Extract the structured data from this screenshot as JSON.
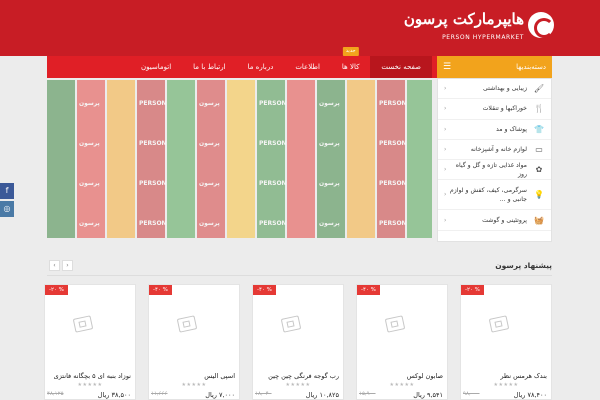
{
  "header": {
    "logo_fa": "هایپرمارکت پرسون",
    "logo_en": "PERSON HYPERMARKET"
  },
  "nav": {
    "categories_label": "دسته‌بندیها",
    "links": [
      {
        "label": "صفحه نخست",
        "badge": ""
      },
      {
        "label": "کالا ها",
        "badge": "جدید"
      },
      {
        "label": "اطلاعات",
        "badge": ""
      },
      {
        "label": "درباره ما",
        "badge": ""
      },
      {
        "label": "ارتباط با ما",
        "badge": ""
      },
      {
        "label": "اتوماسیون",
        "badge": ""
      }
    ]
  },
  "banner": {
    "stripe_texts": [
      "پرسون",
      "PERSON",
      "پرسون",
      "PERSON",
      "پرسون",
      "PERSON",
      "پرسون",
      "PERSON"
    ]
  },
  "categories": [
    {
      "label": "زیبایی و بهداشتی",
      "icon": "brush-icon",
      "glyph": "🖌"
    },
    {
      "label": "خوراکیها و تنقلات",
      "icon": "food-icon",
      "glyph": "🍴"
    },
    {
      "label": "پوشاک و مد",
      "icon": "shirt-icon",
      "glyph": "👕"
    },
    {
      "label": "لوازم خانه و آشپزخانه",
      "icon": "tv-icon",
      "glyph": "▭"
    },
    {
      "label": "مواد غذایی تازه و گل و گیاه روز",
      "icon": "plant-icon",
      "glyph": "✿"
    },
    {
      "label": "سرگرمی، کیف، کفش و لوازم جانبی و ...",
      "icon": "bulb-icon",
      "glyph": "💡"
    },
    {
      "label": "پروتئینی و گوشت",
      "icon": "basket-icon",
      "glyph": "🧺"
    }
  ],
  "social": {
    "facebook": "f",
    "instagram": "◎"
  },
  "suggestions": {
    "title": "پیشنهاد پرسون",
    "prev": "‹",
    "next": "›",
    "products": [
      {
        "discount": "-۲۰ %",
        "name": "بندک هرمس نظر",
        "price": "۷۸,۴۰۰ ریال",
        "old": "۹۸,۰۰۰"
      },
      {
        "discount": "-۴۰ %",
        "name": "صابون لوکس",
        "price": "۹,۵۴۱ ریال",
        "old": "۱۵,۹۰۰"
      },
      {
        "discount": "-۴۰ %",
        "name": "رب گوجه فرنگی چین چین",
        "price": "۱۰,۸۲۵ ریال",
        "old": "۱۸,۰۴۰"
      },
      {
        "discount": "-۴۰ %",
        "name": "اسپی الیس",
        "price": "۷,۰۰۰ ریال",
        "old": "۱۱,۶۶۶"
      },
      {
        "discount": "-۲۰ %",
        "name": "نوزاد بنبه ای ۵ بچگانه فانتزی",
        "price": "۳۸,۵۰۰ ریال",
        "old": "۴۸,۱۲۵"
      }
    ]
  },
  "colors": {
    "brand_red": "#c81d25",
    "nav_red": "#e01f26",
    "accent_orange": "#f2a31c",
    "discount_red": "#e53935"
  }
}
